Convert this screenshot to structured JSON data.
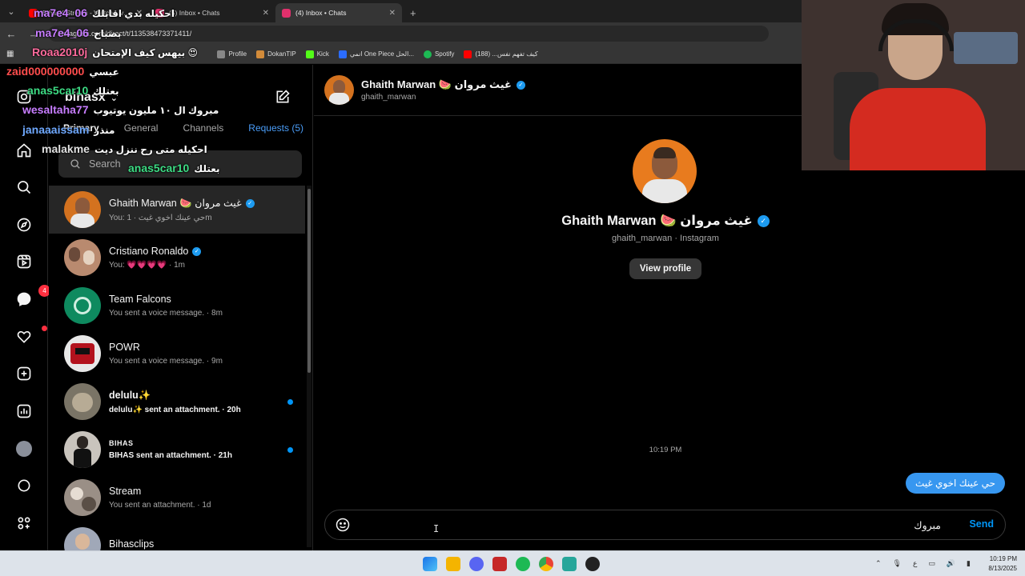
{
  "browser": {
    "tabs": [
      {
        "title": "BihasX Stream - Watch Live on",
        "icon_color": "#ff0000"
      },
      {
        "title": "(5) Inbox • Chats",
        "icon_color": "#e1306c"
      },
      {
        "title": "(4) Inbox • Chats",
        "icon_color": "#e1306c"
      }
    ],
    "new_tab": "+",
    "url": "instagram.com/direct/t/113538473371411/",
    "bookmarks": [
      {
        "label": "Profile",
        "color": "#888888"
      },
      {
        "label": "DokanTIP",
        "color": "#d28b3a"
      },
      {
        "label": "Kick",
        "color": "#53fc18"
      },
      {
        "label": "انمي One Piece الحل...",
        "color": "#2b6cff"
      },
      {
        "label": "Spotify",
        "color": "#1db954"
      },
      {
        "label": "كيف تفهم نفس... (188)",
        "color": "#ff0000"
      }
    ]
  },
  "rail": {
    "notifications_badge": "4"
  },
  "inbox": {
    "username": "bihasx",
    "tabs": [
      "Primary",
      "General",
      "Channels",
      "Requests (5)"
    ],
    "search_placeholder": "Search",
    "threads": [
      {
        "name": "Ghaith Marwan 🍉 غيث مروان",
        "verified": true,
        "preview": "You: حي عينك اخوي غيث · 1m",
        "bold": false,
        "unread": false,
        "avatar": "#d4721f"
      },
      {
        "name": "Cristiano Ronaldo",
        "verified": true,
        "preview": "You: 💗💗💗💗 · 1m",
        "bold": false,
        "unread": false,
        "avatar": "#b98a6f"
      },
      {
        "name": "Team Falcons",
        "verified": false,
        "preview": "You sent a voice message. · 8m",
        "bold": false,
        "unread": false,
        "avatar": "#0e8a5f"
      },
      {
        "name": "POWR",
        "verified": false,
        "preview": "You sent a voice message. · 9m",
        "bold": false,
        "unread": false,
        "avatar": "#e8e8e8"
      },
      {
        "name": "delulu✨",
        "verified": false,
        "preview": "delulu✨ sent an attachment. · 20h",
        "bold": true,
        "unread": true,
        "avatar": "#7a7466"
      },
      {
        "name": "BIHAS",
        "verified": false,
        "preview": "BIHAS sent an attachment. · 21h",
        "bold": true,
        "unread": true,
        "avatar": "#c9c4bd"
      },
      {
        "name": "Stream",
        "verified": false,
        "preview": "You sent an attachment. · 1d",
        "bold": false,
        "unread": false,
        "avatar": "#9a8f86"
      },
      {
        "name": "Bihasclips",
        "verified": false,
        "preview": "",
        "bold": false,
        "unread": false,
        "avatar": "#a0a8b8"
      }
    ]
  },
  "chat": {
    "name": "Ghaith Marwan 🍉 غيث مروان",
    "username": "ghaith_marwan",
    "profile_sub": "ghaith_marwan · Instagram",
    "view_profile": "View profile",
    "timestamp": "10:19 PM",
    "message": "حي عينك اخوي غيث",
    "input_value": "مبروك",
    "send_label": "Send"
  },
  "stream_chat": [
    {
      "user": "ma7e4_06",
      "msg": "احكيله بدي اقابلك",
      "color": "#c77dff"
    },
    {
      "user": "ma7e4_06",
      "msg": "بصباح",
      "color": "#c77dff"
    },
    {
      "user": "Roaa2010j",
      "msg": "بيهس كيف الإمتحان 😍",
      "color": "#ff6b9d"
    },
    {
      "user": "zaid000000000",
      "msg": "عبسي",
      "color": "#ff4d4d"
    },
    {
      "user": "anas5car10",
      "msg": "بعتلك",
      "color": "#3ddc84"
    },
    {
      "user": "wesaltaha77",
      "msg": "مبروك ال ١٠ مليون يوتيوب",
      "color": "#c77dff"
    },
    {
      "user": "janaaaissam",
      "msg": "منذر",
      "color": "#6ea8fe"
    },
    {
      "user": "malakme",
      "msg": "احكيله متى رح ننزل ديت",
      "color": "#e0e0e0"
    },
    {
      "user": "anas5car10",
      "msg": "بعتلك",
      "color": "#3ddc84"
    }
  ],
  "system": {
    "time": "10:19 PM",
    "date": "8/13/2025",
    "tray_lang": "ع"
  }
}
